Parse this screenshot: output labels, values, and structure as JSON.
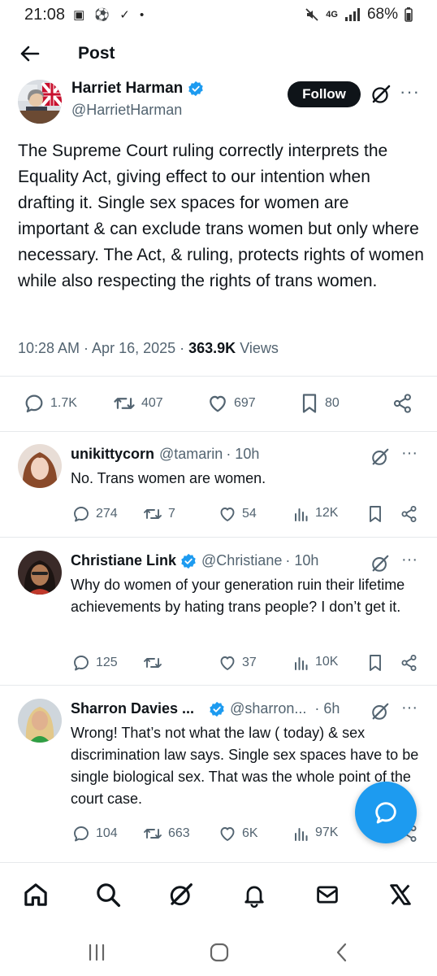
{
  "status_bar": {
    "time": "21:08",
    "left_icons": "▣ ⚽ ✓ •",
    "network": "4G",
    "battery": "68%"
  },
  "header": {
    "title": "Post"
  },
  "main_post": {
    "author": {
      "name": "Harriet Harman",
      "handle": "@HarrietHarman",
      "verified": true
    },
    "follow_label": "Follow",
    "text": "The Supreme Court ruling correctly interprets the Equality Act, giving effect to our intention when drafting it.   Single sex spaces for women are important & can exclude trans women but only where necessary.  The Act, & ruling, protects rights of women while also respecting the rights of trans women.",
    "timestamp": "10:28 AM · Apr 16, 2025 · ",
    "views_count": "363.9K",
    "views_label": " Views",
    "stats": {
      "replies": "1.7K",
      "reposts": "407",
      "likes": "697",
      "bookmarks": "80"
    }
  },
  "replies": [
    {
      "name": "unikittycorn",
      "handle": "@tamarin",
      "time": "· 10h",
      "verified": false,
      "text": "No. Trans women are women.",
      "stats": {
        "replies": "274",
        "reposts": "7",
        "likes": "54",
        "views": "12K"
      }
    },
    {
      "name": "Christiane Link",
      "handle": "@Christiane",
      "time": "· 10h",
      "verified": true,
      "text": "Why do women of your generation ruin their lifetime achievements by hating trans people? I don’t get it.",
      "stats": {
        "replies": "125",
        "reposts": "",
        "likes": "37",
        "views": "10K"
      }
    },
    {
      "name": "Sharron Davies ...",
      "handle": "@sharron...",
      "time": "· 6h",
      "verified": true,
      "text": "Wrong! That’s not what the law ( today) & sex discrimination law says. Single sex spaces have to be single biological sex. That was the whole point of the court case.",
      "stats": {
        "replies": "104",
        "reposts": "663",
        "likes": "6K",
        "views": "97K"
      }
    }
  ],
  "colors": {
    "accent": "#1d9bf0",
    "text": "#0f1419",
    "muted": "#536471",
    "verified": "#1d9bf0"
  }
}
